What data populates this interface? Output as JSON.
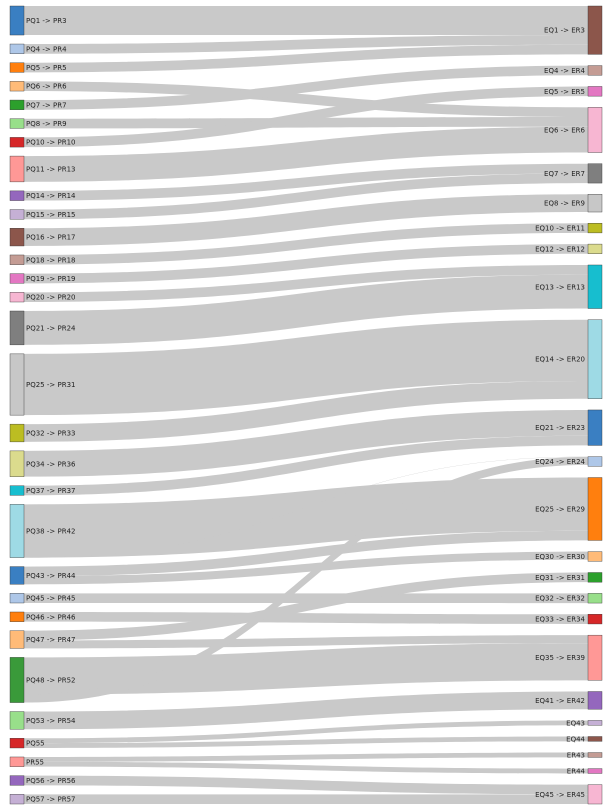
{
  "chart_data": {
    "type": "sankey",
    "left_nodes": [
      {
        "id": "L1",
        "label": "PQ1 -> PR3",
        "value": 18,
        "color": "#3a7fc2"
      },
      {
        "id": "L2",
        "label": "PQ4 -> PR4",
        "value": 6,
        "color": "#aec7e8"
      },
      {
        "id": "L3",
        "label": "PQ5 -> PR5",
        "value": 6,
        "color": "#ff7f0e"
      },
      {
        "id": "L4",
        "label": "PQ6 -> PR6",
        "value": 6,
        "color": "#ffbb78"
      },
      {
        "id": "L5",
        "label": "PQ7 -> PR7",
        "value": 6,
        "color": "#2ca02c"
      },
      {
        "id": "L6",
        "label": "PQ8 -> PR9",
        "value": 6,
        "color": "#98df8a"
      },
      {
        "id": "L7",
        "label": "PQ10 -> PR10",
        "value": 6,
        "color": "#d62728"
      },
      {
        "id": "L8",
        "label": "PQ11 -> PR13",
        "value": 16,
        "color": "#ff9896"
      },
      {
        "id": "L9",
        "label": "PQ14 -> PR14",
        "value": 6,
        "color": "#9467bd"
      },
      {
        "id": "L10",
        "label": "PQ15 -> PR15",
        "value": 6,
        "color": "#c5b0d5"
      },
      {
        "id": "L11",
        "label": "PQ16 -> PR17",
        "value": 11,
        "color": "#8c564b"
      },
      {
        "id": "L12",
        "label": "PQ18 -> PR18",
        "value": 6,
        "color": "#c49c94"
      },
      {
        "id": "L13",
        "label": "PQ19 -> PR19",
        "value": 6,
        "color": "#e377c2"
      },
      {
        "id": "L14",
        "label": "PQ20 -> PR20",
        "value": 6,
        "color": "#f7b6d2"
      },
      {
        "id": "L15",
        "label": "PQ21 -> PR24",
        "value": 21,
        "color": "#7f7f7f"
      },
      {
        "id": "L16",
        "label": "PQ25 -> PR31",
        "value": 38,
        "color": "#c7c7c7"
      },
      {
        "id": "L17",
        "label": "PQ32 -> PR33",
        "value": 11,
        "color": "#bcbd22"
      },
      {
        "id": "L18",
        "label": "PQ34 -> PR36",
        "value": 16,
        "color": "#dbdb8d"
      },
      {
        "id": "L19",
        "label": "PQ37 -> PR37",
        "value": 6,
        "color": "#17becf"
      },
      {
        "id": "L20",
        "label": "PQ38 -> PR42",
        "value": 33,
        "color": "#9edae5"
      },
      {
        "id": "L21",
        "label": "PQ43 -> PR44",
        "value": 11,
        "color": "#3a7fc2"
      },
      {
        "id": "L22",
        "label": "PQ45 -> PR45",
        "value": 6,
        "color": "#aec7e8"
      },
      {
        "id": "L23",
        "label": "PQ46 -> PR46",
        "value": 6,
        "color": "#ff7f0e"
      },
      {
        "id": "L24",
        "label": "PQ47 -> PR47",
        "value": 11,
        "color": "#ffbb78"
      },
      {
        "id": "L25",
        "label": "PQ48 -> PR52",
        "value": 28,
        "color": "#3a9a3a"
      },
      {
        "id": "L26",
        "label": "PQ53 -> PR54",
        "value": 11,
        "color": "#98df8a"
      },
      {
        "id": "L27",
        "label": "PQ55",
        "value": 6,
        "color": "#d62728"
      },
      {
        "id": "L28",
        "label": "PR55",
        "value": 6,
        "color": "#ff9896"
      },
      {
        "id": "L29",
        "label": "PQ56 -> PR56",
        "value": 6,
        "color": "#9467bd"
      },
      {
        "id": "L30",
        "label": "PQ57 -> PR57",
        "value": 6,
        "color": "#c5b0d5"
      }
    ],
    "right_nodes": [
      {
        "id": "R1",
        "label": "EQ1 -> ER3",
        "value": 30,
        "color": "#8c564b"
      },
      {
        "id": "R2",
        "label": "EQ4 -> ER4",
        "value": 6,
        "color": "#c49c94"
      },
      {
        "id": "R3",
        "label": "EQ5 -> ER5",
        "value": 6,
        "color": "#e377c2"
      },
      {
        "id": "R4",
        "label": "EQ6 -> ER6",
        "value": 28,
        "color": "#f7b6d2"
      },
      {
        "id": "R5",
        "label": "EQ7 -> ER7",
        "value": 12,
        "color": "#7f7f7f"
      },
      {
        "id": "R6",
        "label": "EQ8 -> ER9",
        "value": 11,
        "color": "#c7c7c7"
      },
      {
        "id": "R7",
        "label": "EQ10 -> ER11",
        "value": 6,
        "color": "#bcbd22"
      },
      {
        "id": "R8",
        "label": "EQ12 -> ER12",
        "value": 6,
        "color": "#dbdb8d"
      },
      {
        "id": "R9",
        "label": "EQ13 -> ER13",
        "value": 27,
        "color": "#17becf"
      },
      {
        "id": "R10",
        "label": "EQ14 -> ER20",
        "value": 49,
        "color": "#9edae5"
      },
      {
        "id": "R11",
        "label": "EQ21 -> ER23",
        "value": 22,
        "color": "#3a7fc2"
      },
      {
        "id": "R12",
        "label": "EQ24 -> ER24",
        "value": 6,
        "color": "#aec7e8"
      },
      {
        "id": "R13",
        "label": "EQ25 -> ER29",
        "value": 39,
        "color": "#ff7f0e"
      },
      {
        "id": "R14",
        "label": "EQ30 -> ER30",
        "value": 6,
        "color": "#ffbb78"
      },
      {
        "id": "R15",
        "label": "EQ31 -> ER31",
        "value": 6,
        "color": "#2ca02c"
      },
      {
        "id": "R16",
        "label": "EQ32 -> ER32",
        "value": 6,
        "color": "#98df8a"
      },
      {
        "id": "R17",
        "label": "EQ33 -> ER34",
        "value": 6,
        "color": "#d62728"
      },
      {
        "id": "R18",
        "label": "EQ35 -> ER39",
        "value": 28,
        "color": "#ff9896"
      },
      {
        "id": "R19",
        "label": "EQ41 -> ER42",
        "value": 11,
        "color": "#9467bd"
      },
      {
        "id": "R20",
        "label": "EQ43",
        "value": 3,
        "color": "#c5b0d5"
      },
      {
        "id": "R21",
        "label": "EQ44",
        "value": 3,
        "color": "#8c564b"
      },
      {
        "id": "R22",
        "label": "ER43",
        "value": 3,
        "color": "#c49c94"
      },
      {
        "id": "R23",
        "label": "ER44",
        "value": 3,
        "color": "#e377c2"
      },
      {
        "id": "R24",
        "label": "EQ45 -> ER45",
        "value": 12,
        "color": "#f7b6d2"
      }
    ],
    "links": [
      {
        "source": "L1",
        "target": "R1",
        "value": 18
      },
      {
        "source": "L2",
        "target": "R1",
        "value": 6
      },
      {
        "source": "L3",
        "target": "R1",
        "value": 6
      },
      {
        "source": "L4",
        "target": "R4",
        "value": 6
      },
      {
        "source": "L5",
        "target": "R2",
        "value": 6
      },
      {
        "source": "L6",
        "target": "R4",
        "value": 6
      },
      {
        "source": "L7",
        "target": "R3",
        "value": 6
      },
      {
        "source": "L8",
        "target": "R4",
        "value": 16
      },
      {
        "source": "L9",
        "target": "R5",
        "value": 6
      },
      {
        "source": "L10",
        "target": "R5",
        "value": 6
      },
      {
        "source": "L11",
        "target": "R6",
        "value": 11
      },
      {
        "source": "L12",
        "target": "R7",
        "value": 6
      },
      {
        "source": "L13",
        "target": "R8",
        "value": 6
      },
      {
        "source": "L14",
        "target": "R9",
        "value": 6
      },
      {
        "source": "L15",
        "target": "R9",
        "value": 21
      },
      {
        "source": "L16",
        "target": "R10",
        "value": 38
      },
      {
        "source": "L17",
        "target": "R10",
        "value": 11
      },
      {
        "source": "L18",
        "target": "R11",
        "value": 16
      },
      {
        "source": "L19",
        "target": "R11",
        "value": 6
      },
      {
        "source": "L20",
        "target": "R13",
        "value": 33
      },
      {
        "source": "L20",
        "target": "R12",
        "value": 0.01
      },
      {
        "source": "L21",
        "target": "R13",
        "value": 6
      },
      {
        "source": "L21",
        "target": "R14",
        "value": 5
      },
      {
        "source": "L22",
        "target": "R16",
        "value": 6
      },
      {
        "source": "L23",
        "target": "R17",
        "value": 6
      },
      {
        "source": "L24",
        "target": "R15",
        "value": 6
      },
      {
        "source": "L24",
        "target": "R18",
        "value": 5
      },
      {
        "source": "L25",
        "target": "R18",
        "value": 23
      },
      {
        "source": "L25",
        "target": "R12",
        "value": 5
      },
      {
        "source": "L26",
        "target": "R19",
        "value": 11
      },
      {
        "source": "L27",
        "target": "R20",
        "value": 3
      },
      {
        "source": "L27",
        "target": "R21",
        "value": 3
      },
      {
        "source": "L28",
        "target": "R22",
        "value": 3
      },
      {
        "source": "L28",
        "target": "R23",
        "value": 3
      },
      {
        "source": "L29",
        "target": "R24",
        "value": 6
      },
      {
        "source": "L30",
        "target": "R24",
        "value": 6
      }
    ]
  }
}
